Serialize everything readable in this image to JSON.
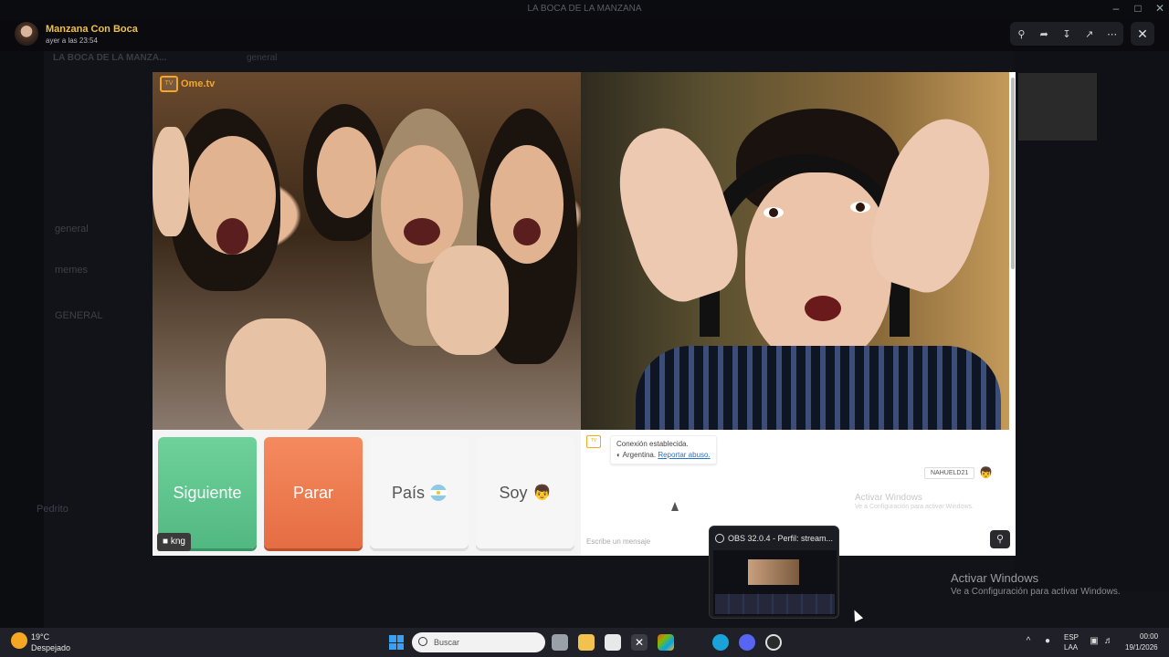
{
  "window": {
    "title": "LA BOCA DE LA MANZANA"
  },
  "viewer": {
    "author": "Manzana Con Boca",
    "timestamp": "ayer a las 23:54"
  },
  "background": {
    "server_name": "LA BOCA DE LA MANZA...",
    "channel_top": "general",
    "channels": [
      "general",
      "memes",
      "GENERAL",
      "Pedrito"
    ]
  },
  "ometv": {
    "logo_text": "Ome.tv",
    "buttons": {
      "next": "Siguiente",
      "stop": "Parar",
      "country": "País",
      "soy": "Soy"
    },
    "kng_label": "kng",
    "chat": {
      "status_line": "Conexión establecida.",
      "country_line": "Argentina.",
      "report_link": "Reportar abuso.",
      "user_tag": "NAHUELD21",
      "watermark_title": "Activar Windows",
      "watermark_sub": "Ve a Configuración para activar Windows.",
      "input_placeholder": "Escribe un mensaje"
    }
  },
  "obs_preview": {
    "title": "OBS 32.0.4 - Perfil: stream..."
  },
  "activate_windows": {
    "title": "Activar Windows",
    "subtitle": "Ve a Configuración para activar Windows."
  },
  "taskbar": {
    "weather_temp": "19°C",
    "weather_desc": "Despejado",
    "search_placeholder": "Buscar",
    "lang_1": "ESP",
    "lang_2": "LAA",
    "time": "00:00",
    "date": "19/1/2026"
  },
  "colors": {
    "next_green": "#5cc08c",
    "stop_orange": "#ec7a4e",
    "ome_orange": "#f5a623",
    "author_gold": "#f0c040"
  }
}
